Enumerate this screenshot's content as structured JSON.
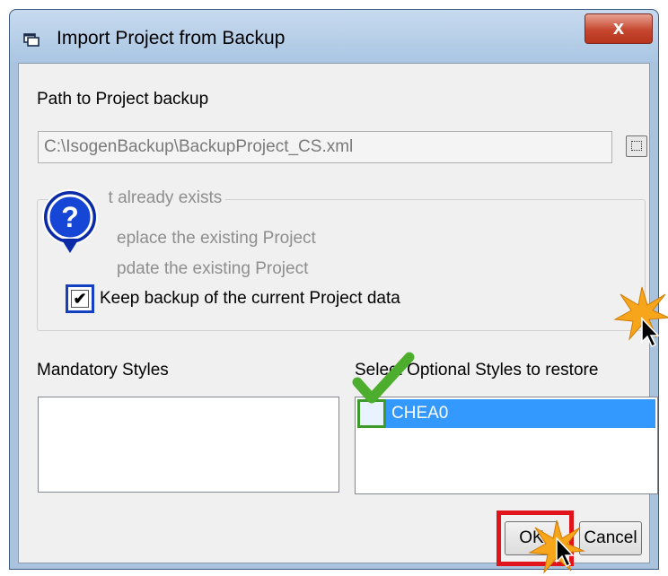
{
  "window": {
    "title": "Import Project from Backup",
    "close_label": "x"
  },
  "path": {
    "label": "Path to Project backup",
    "value": "C:\\IsogenBackup\\BackupProject_CS.xml"
  },
  "project_exists_group": {
    "legend": "Project already exists",
    "legend_visible": "P        t already exists",
    "replace_label": "Replace the existing Project",
    "replace_visible": "eplace the existing Project",
    "update_label": "Update the existing Project",
    "update_visible": "pdate the existing Project",
    "keep_backup_label": "Keep backup of the current Project data",
    "keep_backup_checked": true
  },
  "mandatory_styles": {
    "label": "Mandatory Styles",
    "items": []
  },
  "optional_styles": {
    "label": "Select Optional Styles to restore",
    "items": [
      {
        "name": "CHEA0",
        "checked": false,
        "selected": true
      }
    ]
  },
  "buttons": {
    "ok": "OK",
    "cancel": "Cancel"
  },
  "annotations": {
    "help_symbol": "?"
  },
  "colors": {
    "highlight_box": "#1340c0",
    "ok_frame": "#e1131b",
    "list_selection": "#3399ff",
    "check_mark": "#3d9a2c"
  }
}
